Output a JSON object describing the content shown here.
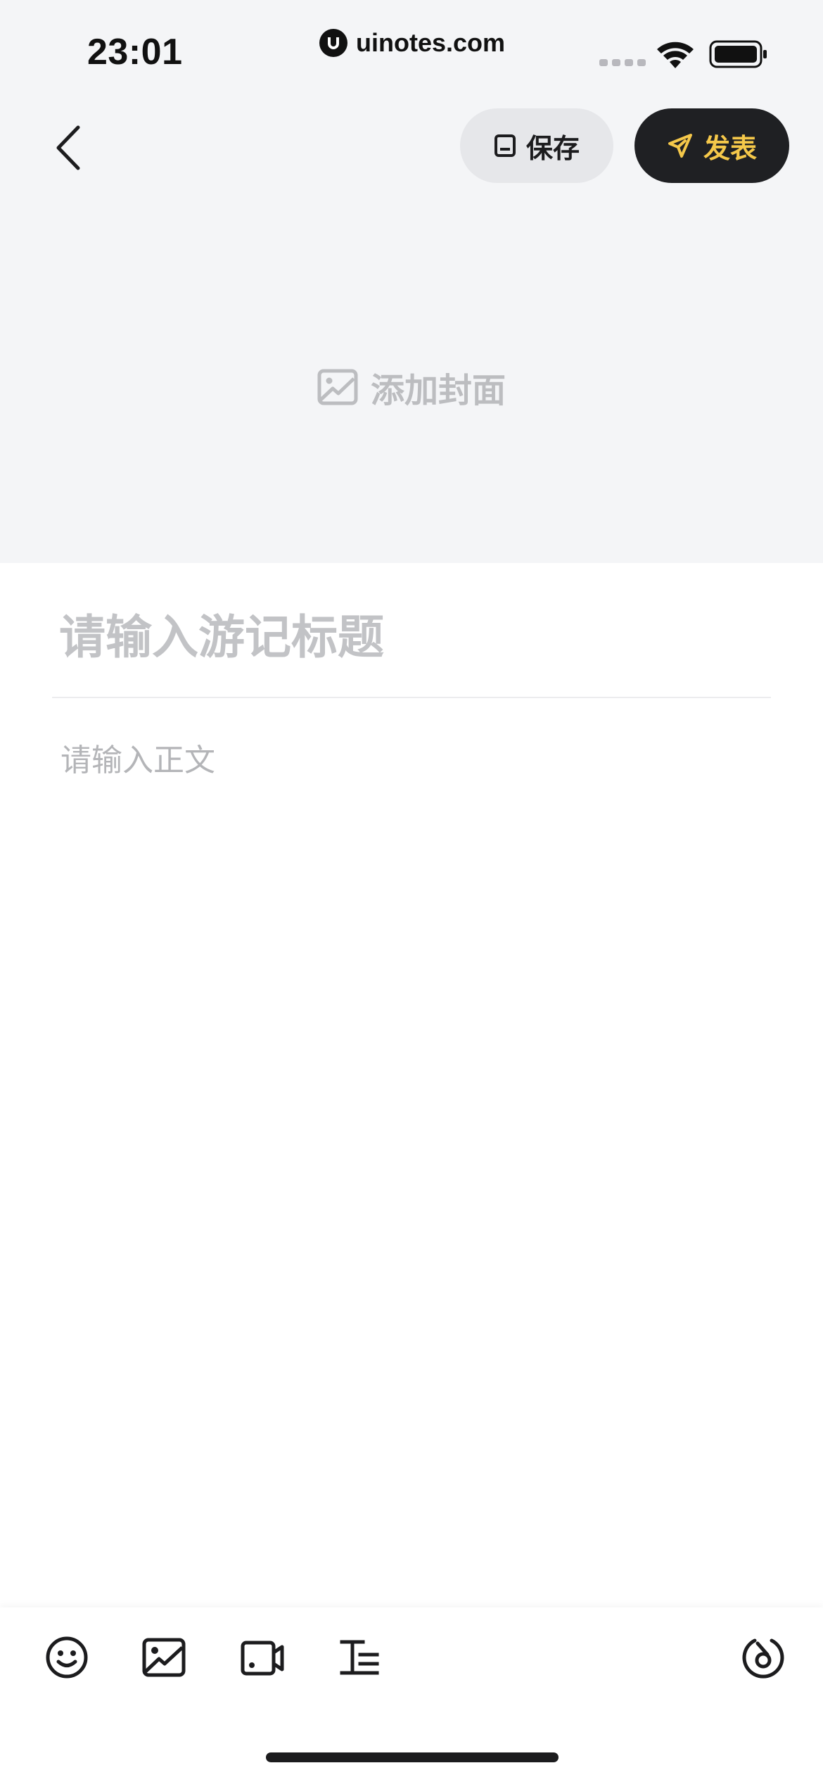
{
  "status_bar": {
    "time": "23:01",
    "url": "uinotes.com"
  },
  "nav": {
    "back_icon": "chevron-left-icon",
    "save_label": "保存",
    "publish_label": "发表"
  },
  "cover": {
    "icon": "image-icon",
    "label": "添加封面"
  },
  "editor": {
    "title_placeholder": "请输入游记标题",
    "body_placeholder": "请输入正文"
  },
  "toolbar": {
    "items": [
      "emoji-icon",
      "image-icon",
      "video-icon",
      "text-format-icon"
    ],
    "right_item": "location-icon"
  },
  "colors": {
    "top_background": "#f4f5f7",
    "publish_background": "#1f2023",
    "publish_text": "#f5c84a",
    "placeholder_text": "#c2c3c6"
  }
}
